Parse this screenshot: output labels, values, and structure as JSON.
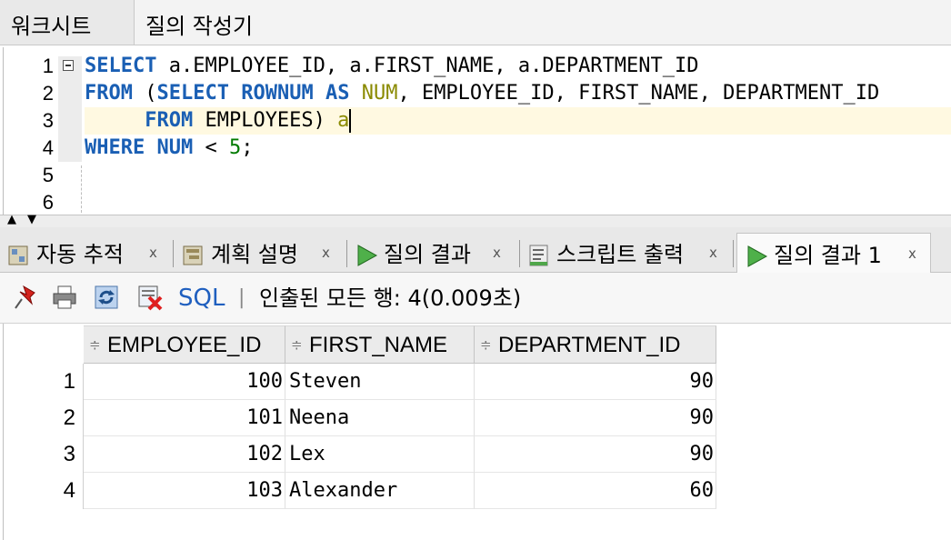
{
  "top_tabs": {
    "worksheet": "워크시트",
    "query_builder": "질의 작성기"
  },
  "editor": {
    "line_numbers": [
      "1",
      "2",
      "3",
      "4",
      "5",
      "6"
    ],
    "lines": [
      [
        {
          "t": "SELECT",
          "c": "kw"
        },
        {
          "t": " a.EMPLOYEE_ID, a.FIRST_NAME, a.DEPARTMENT_ID",
          "c": ""
        }
      ],
      [
        {
          "t": "FROM",
          "c": "kw"
        },
        {
          "t": " (",
          "c": ""
        },
        {
          "t": "SELECT",
          "c": "kw"
        },
        {
          "t": " ",
          "c": ""
        },
        {
          "t": "ROWNUM",
          "c": "kw"
        },
        {
          "t": " ",
          "c": ""
        },
        {
          "t": "AS",
          "c": "kw"
        },
        {
          "t": " ",
          "c": ""
        },
        {
          "t": "NUM",
          "c": "al"
        },
        {
          "t": ", EMPLOYEE_ID, FIRST_NAME, DEPARTMENT_ID",
          "c": ""
        }
      ],
      [
        {
          "t": "     ",
          "c": ""
        },
        {
          "t": "FROM",
          "c": "kw"
        },
        {
          "t": " EMPLOYEES) ",
          "c": ""
        },
        {
          "t": "a",
          "c": "al"
        }
      ],
      [
        {
          "t": "WHERE",
          "c": "kw"
        },
        {
          "t": " ",
          "c": ""
        },
        {
          "t": "NUM",
          "c": "kw"
        },
        {
          "t": " < ",
          "c": ""
        },
        {
          "t": "5",
          "c": "nm"
        },
        {
          "t": ";",
          "c": ""
        }
      ]
    ],
    "current_line": 3
  },
  "bottom_tabs": [
    {
      "label": "자동 추적",
      "icon": "autotrace-icon",
      "close": "x",
      "active": false
    },
    {
      "label": "계획 설명",
      "icon": "explain-plan-icon",
      "close": "x",
      "active": false
    },
    {
      "label": "질의 결과",
      "icon": "run-icon",
      "close": "x",
      "active": false
    },
    {
      "label": "스크립트 출력",
      "icon": "script-output-icon",
      "close": "x",
      "active": false
    },
    {
      "label": "질의 결과 1",
      "icon": "run-icon",
      "close": "x",
      "active": true
    }
  ],
  "toolbar": {
    "icons": [
      "pin-icon",
      "print-icon",
      "refresh-icon",
      "delete-icon"
    ],
    "sql_label": "SQL",
    "separator": "|",
    "status": "인출된 모든 행: 4(0.009초)"
  },
  "grid": {
    "columns": [
      "EMPLOYEE_ID",
      "FIRST_NAME",
      "DEPARTMENT_ID"
    ],
    "sort_icon": "≑",
    "rows": [
      {
        "n": "1",
        "EMPLOYEE_ID": "100",
        "FIRST_NAME": "Steven",
        "DEPARTMENT_ID": "90"
      },
      {
        "n": "2",
        "EMPLOYEE_ID": "101",
        "FIRST_NAME": "Neena",
        "DEPARTMENT_ID": "90"
      },
      {
        "n": "3",
        "EMPLOYEE_ID": "102",
        "FIRST_NAME": "Lex",
        "DEPARTMENT_ID": "90"
      },
      {
        "n": "4",
        "EMPLOYEE_ID": "103",
        "FIRST_NAME": "Alexander",
        "DEPARTMENT_ID": "60"
      }
    ]
  },
  "colors": {
    "keyword": "#1a5fb4",
    "alias": "#8a8a00",
    "number": "#007a00",
    "sql_button": "#1f5fbf",
    "current_line": "#fff9e1"
  }
}
